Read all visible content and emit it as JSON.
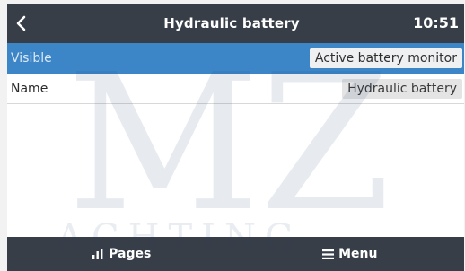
{
  "header": {
    "title": "Hydraulic battery",
    "time": "10:51"
  },
  "rows": [
    {
      "label": "Visible",
      "value": "Active battery monitor"
    },
    {
      "label": "Name",
      "value": "Hydraulic battery"
    }
  ],
  "watermark": {
    "big": "MZ",
    "small": "ACHTING"
  },
  "footer": {
    "pages_label": "Pages",
    "menu_label": "Menu"
  },
  "colors": {
    "bar": "#383e48",
    "selected": "#3c86c8",
    "background": "#ffffff"
  },
  "icons": {
    "back": "chevron-left-icon",
    "pages": "bar-chart-icon",
    "menu": "hamburger-menu-icon"
  }
}
